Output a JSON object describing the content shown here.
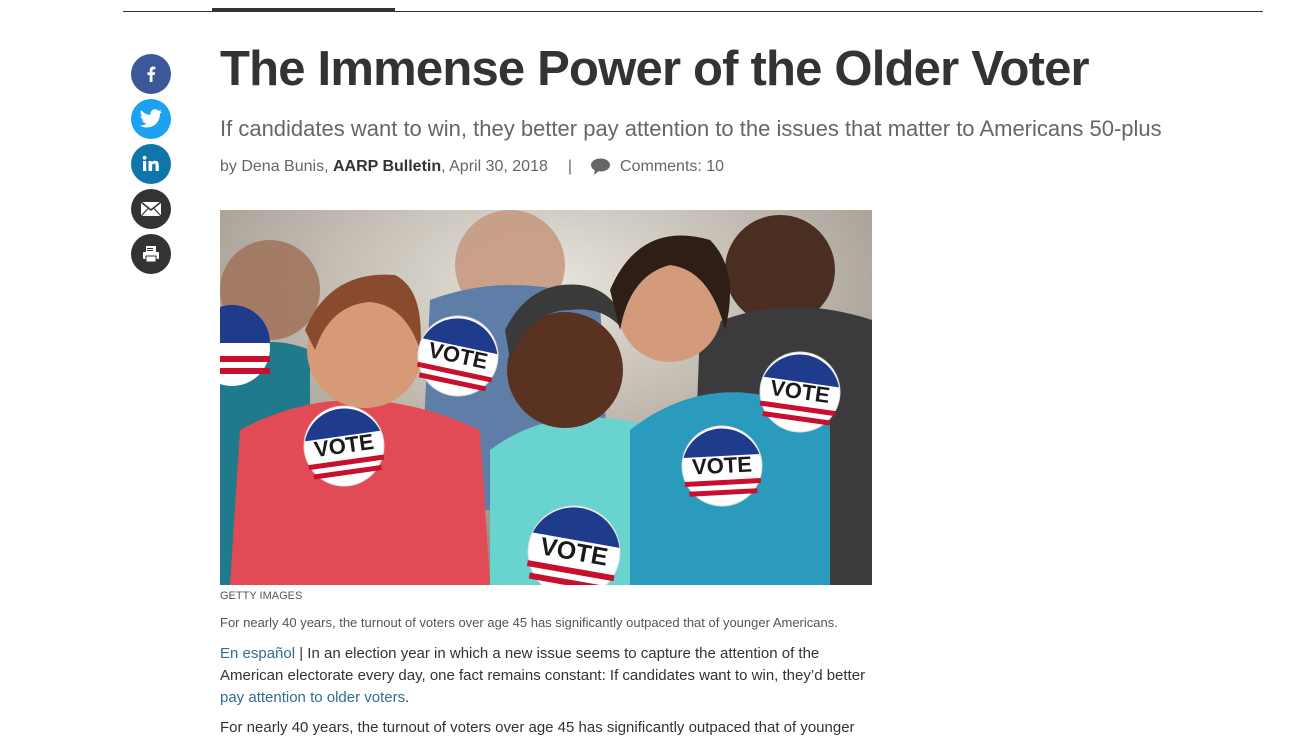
{
  "article": {
    "title": "The Immense Power of the Older Voter",
    "subtitle": "If candidates want to win, they better pay attention to the issues that matter to Americans 50-plus",
    "byline": {
      "prefix": "by Dena Bunis,",
      "publication": "AARP Bulletin",
      "date": ", April 30, 2018",
      "separator": "|",
      "comments": "Comments: 10"
    },
    "image": {
      "credit": "GETTY IMAGES",
      "caption": "For nearly 40 years, the turnout of voters over age 45 has significantly outpaced that of younger Americans.",
      "button_text": "VOTE"
    },
    "paragraph1": {
      "link1": "En español",
      "text1": " | In an election year in which a new issue seems to capture the attention of the American electorate every day, one fact remains constant: If candidates want to win, they’d better ",
      "link2": "pay attention to older voters",
      "text2": "."
    },
    "paragraph2": "For nearly 40 years, the turnout of voters over age 45 has significantly outpaced that of younger"
  },
  "share": {
    "icons": [
      "facebook-icon",
      "twitter-icon",
      "linkedin-icon",
      "email-icon",
      "print-icon"
    ]
  },
  "colors": {
    "facebook": "#3b5998",
    "twitter": "#1da1f2",
    "linkedin": "#0e76a8",
    "email": "#333333",
    "print": "#333333",
    "link": "#2f6e94"
  }
}
